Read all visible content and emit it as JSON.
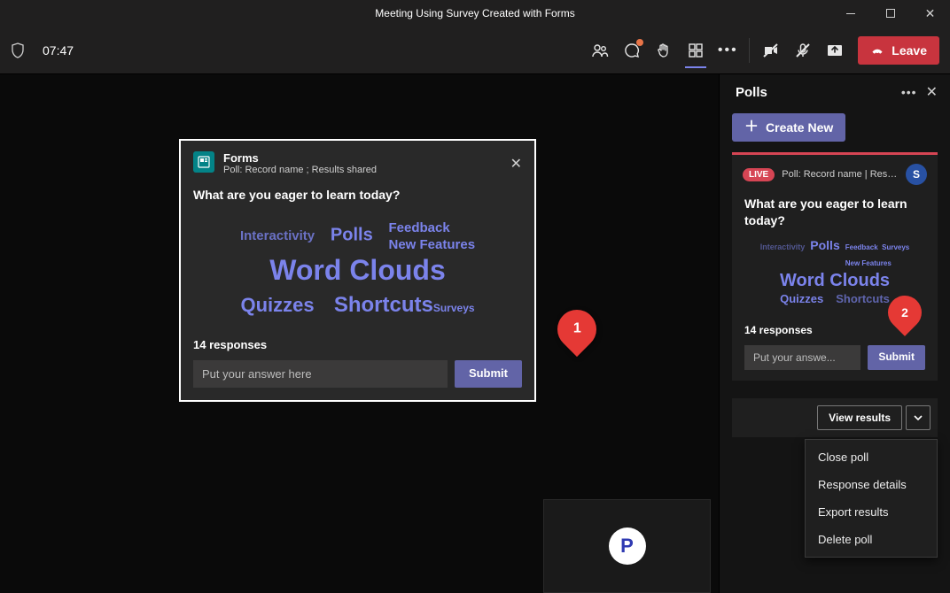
{
  "window": {
    "title": "Meeting Using Survey Created with Forms"
  },
  "meeting": {
    "time": "07:47",
    "leave_label": "Leave"
  },
  "panel": {
    "title": "Polls",
    "create_label": "Create New",
    "live_label": "LIVE",
    "subtitle": "Poll: Record name | Results s...",
    "view_results_label": "View results",
    "menu": [
      "Close poll",
      "Response details",
      "Export results",
      "Delete poll"
    ]
  },
  "main_poll": {
    "app": "Forms",
    "subtitle": "Poll: Record name ; Results shared",
    "question": "What are you eager to learn today?",
    "words": {
      "interactivity": "Interactivity",
      "polls": "Polls",
      "feedback": "Feedback",
      "newfeatures": "New Features",
      "wordclouds": "Word Clouds",
      "quizzes": "Quizzes",
      "shortcuts": "Shortcuts",
      "surveys": "Surveys"
    },
    "responses": "14 responses",
    "placeholder": "Put your answer here",
    "submit": "Submit"
  },
  "side_poll": {
    "question": "What are you eager to learn today?",
    "responses": "14 responses",
    "placeholder": "Put your answe...",
    "submit": "Submit",
    "words": {
      "interactivity": "Interactivity",
      "polls": "Polls",
      "feedback": "Feedback",
      "surveys": "Surveys",
      "newfeatures": "New Features",
      "wordclouds": "Word Clouds",
      "quizzes": "Quizzes",
      "shortcuts": "Shortcuts"
    }
  },
  "markers": {
    "one": "1",
    "two": "2"
  },
  "participant": {
    "initial": "P"
  },
  "avatar": {
    "initial": "S"
  }
}
